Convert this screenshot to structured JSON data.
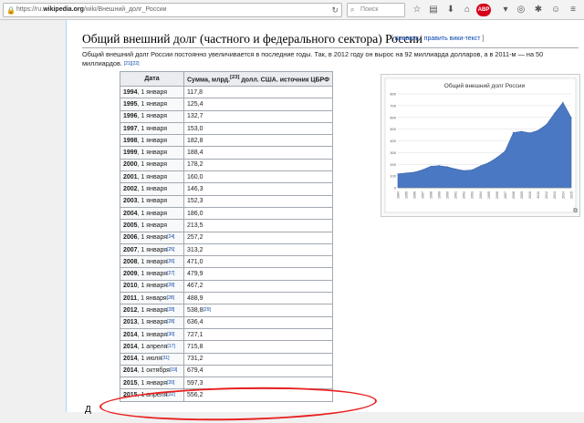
{
  "browser": {
    "url_host": "https://ru.",
    "url_bold": "wikipedia.org",
    "url_rest": "/wiki/Внешний_долг_России",
    "search_placeholder": "Поиск",
    "abp_label": "ABP"
  },
  "article": {
    "heading": "Общий внешний долг (частного и федерального сектора) России",
    "edit_links": {
      "open": "[ ",
      "edit": "править",
      "sep": " | ",
      "edit_wiki": "править вики-текст",
      "close": " ]"
    },
    "paragraph": "Общий внешний долг России постоянно увеличивается в последние годы. Так, в 2012 году он вырос на 92 миллиарда долларов, а в 2011-м — на 50 миллиардов.",
    "paragraph_refs": "[21][22]",
    "next_char": "Д"
  },
  "table": {
    "headers": [
      "Дата",
      "Сумма, млрд.",
      "[23]",
      " долл. США. источник ЦБРФ"
    ],
    "rows": [
      {
        "year": "1994",
        "date": ", 1 января",
        "ref": "",
        "value": "117,8"
      },
      {
        "year": "1995",
        "date": ", 1 января",
        "ref": "",
        "value": "125,4"
      },
      {
        "year": "1996",
        "date": ", 1 января",
        "ref": "",
        "value": "132,7"
      },
      {
        "year": "1997",
        "date": ", 1 января",
        "ref": "",
        "value": "153,0"
      },
      {
        "year": "1998",
        "date": ", 1 января",
        "ref": "",
        "value": "182,8"
      },
      {
        "year": "1999",
        "date": ", 1 января",
        "ref": "",
        "value": "188,4"
      },
      {
        "year": "2000",
        "date": ", 1 января",
        "ref": "",
        "value": "178,2"
      },
      {
        "year": "2001",
        "date": ", 1 января",
        "ref": "",
        "value": "160,0"
      },
      {
        "year": "2002",
        "date": ", 1 января",
        "ref": "",
        "value": "146,3"
      },
      {
        "year": "2003",
        "date": ", 1 января",
        "ref": "",
        "value": "152,3"
      },
      {
        "year": "2004",
        "date": ", 1 января",
        "ref": "",
        "value": "186,0"
      },
      {
        "year": "2005",
        "date": ", 1 января",
        "ref": "",
        "value": "213,5"
      },
      {
        "year": "2006",
        "date": ", 1 января",
        "ref": "[24]",
        "value": "257,2"
      },
      {
        "year": "2007",
        "date": ", 1 января",
        "ref": "[25]",
        "value": "313,2"
      },
      {
        "year": "2008",
        "date": ", 1 января",
        "ref": "[26]",
        "value": "471,0"
      },
      {
        "year": "2009",
        "date": ", 1 января",
        "ref": "[27]",
        "value": "479,9"
      },
      {
        "year": "2010",
        "date": ", 1 января",
        "ref": "[28]",
        "value": "467,2"
      },
      {
        "year": "2011",
        "date": ", 1 января",
        "ref": "[28]",
        "value": "488,9"
      },
      {
        "year": "2012",
        "date": ", 1 января",
        "ref": "[28]",
        "value": "538,8",
        "value_ref": "[29]"
      },
      {
        "year": "2013",
        "date": ", 1 января",
        "ref": "[28]",
        "value": "636,4"
      },
      {
        "year": "2014",
        "date": ", 1 января",
        "ref": "[30]",
        "value": "727,1"
      },
      {
        "year": "2014",
        "date": ", 1 апреля",
        "ref": "[17]",
        "value": "715,8"
      },
      {
        "year": "2014",
        "date": ", 1 июля",
        "ref": "[31]",
        "value": "731,2"
      },
      {
        "year": "2014",
        "date": ", 1 октября",
        "ref": "[19]",
        "value": "679,4"
      },
      {
        "year": "2015",
        "date": ", 1 января",
        "ref": "[20]",
        "value": "597,3"
      },
      {
        "year": "2015",
        "date": ", 1 апреля",
        "ref": "[32]",
        "value": "556,2"
      }
    ]
  },
  "colors": {
    "link": "#0645ad",
    "area_fill": "#4a78c2",
    "highlight": "#e82020"
  },
  "chart_data": {
    "type": "area",
    "title": "Общий внешний долг России",
    "x": [
      1994,
      1995,
      1996,
      1997,
      1998,
      1999,
      2000,
      2001,
      2002,
      2003,
      2004,
      2005,
      2006,
      2007,
      2008,
      2009,
      2010,
      2011,
      2012,
      2013,
      2014,
      2015
    ],
    "values": [
      117.8,
      125.4,
      132.7,
      153.0,
      182.8,
      188.4,
      178.2,
      160.0,
      146.3,
      152.3,
      186.0,
      213.5,
      257.2,
      313.2,
      471.0,
      479.9,
      467.2,
      488.9,
      538.8,
      636.4,
      727.1,
      597.3
    ],
    "ylim": [
      0,
      800
    ],
    "yticks": [
      0,
      100,
      200,
      300,
      400,
      500,
      600,
      700,
      800
    ],
    "grid": true,
    "legend": "none"
  }
}
